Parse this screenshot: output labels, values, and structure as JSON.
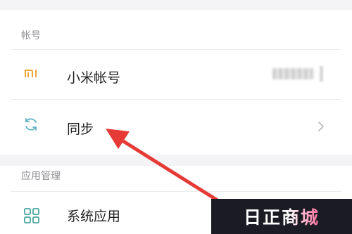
{
  "sections": {
    "account": {
      "header": "帐号",
      "items": [
        {
          "label": "小米帐号",
          "icon": "mi-logo-icon"
        },
        {
          "label": "同步",
          "icon": "sync-icon"
        }
      ]
    },
    "apps": {
      "header": "应用管理",
      "items": [
        {
          "label": "系统应用",
          "icon": "apps-grid-icon"
        }
      ]
    }
  },
  "watermark": {
    "text": "日正商城"
  },
  "colors": {
    "mi_orange": "#f0a43a",
    "sync_teal": "#5fb4c8",
    "apps_teal": "#4aa6a0",
    "arrow_red": "#e53a36",
    "background": "#f4f4f6"
  }
}
